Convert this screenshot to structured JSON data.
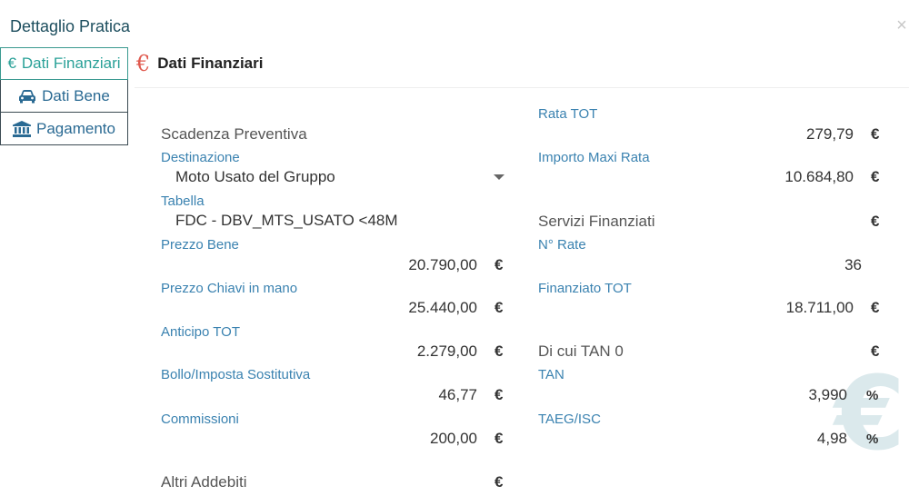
{
  "modal": {
    "title": "Dettaglio Pratica",
    "close_glyph": "×"
  },
  "tabs": [
    {
      "label": "Dati Finanziari",
      "icon": "euro-icon",
      "glyph": "€",
      "active": true
    },
    {
      "label": "Dati Bene",
      "icon": "car-icon",
      "active": false
    },
    {
      "label": "Pagamento",
      "icon": "bank-icon",
      "active": false
    }
  ],
  "section": {
    "icon": "euro-icon",
    "glyph": "€",
    "title": "Dati Finanziari"
  },
  "currency": "€",
  "percent": "%",
  "left": {
    "scadenza_preventiva": {
      "label": "Scadenza Preventiva"
    },
    "destinazione": {
      "label": "Destinazione",
      "value": "Moto Usato del Gruppo"
    },
    "tabella": {
      "label": "Tabella",
      "value": "FDC - DBV_MTS_USATO <48M"
    },
    "prezzo_bene": {
      "label": "Prezzo Bene",
      "value": "20.790,00"
    },
    "prezzo_chiavi": {
      "label": "Prezzo Chiavi in mano",
      "value": "25.440,00"
    },
    "anticipo": {
      "label": "Anticipo TOT",
      "value": "2.279,00"
    },
    "bollo": {
      "label": "Bollo/Imposta Sostitutiva",
      "value": "46,77"
    },
    "commissioni": {
      "label": "Commissioni",
      "value": "200,00"
    },
    "altri_addebiti": {
      "label": "Altri Addebiti"
    }
  },
  "right": {
    "rata_tot": {
      "label": "Rata TOT",
      "value": "279,79"
    },
    "maxi_rata": {
      "label": "Importo Maxi Rata",
      "value": "10.684,80"
    },
    "servizi": {
      "label": "Servizi Finanziati"
    },
    "n_rate": {
      "label": "N° Rate",
      "value": "36"
    },
    "finanziato": {
      "label": "Finanziato TOT",
      "value": "18.711,00"
    },
    "tan0": {
      "label": "Di cui TAN 0"
    },
    "tan": {
      "label": "TAN",
      "value": "3,990"
    },
    "taeg": {
      "label": "TAEG/ISC",
      "value": "4,98"
    }
  },
  "watermark": {
    "icon": "euro-icon",
    "glyph": "€"
  }
}
